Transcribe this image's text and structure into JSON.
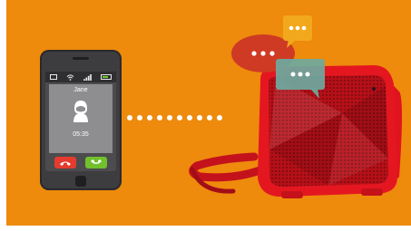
{
  "phone": {
    "contact_name": "Jane",
    "call_time": "05:35",
    "icons": [
      "mail-icon",
      "wifi-icon",
      "signal-icon",
      "battery-icon",
      "decline-call-icon",
      "accept-call-icon"
    ]
  },
  "colors": {
    "background": "#ee8a0c",
    "speaker_red": "#d8141f",
    "decline": "#e53b2f",
    "accept": "#72c02c",
    "bubble_red": "#cf3a24",
    "bubble_yellow": "#f2a81c",
    "bubble_teal": "#6ea9a0"
  },
  "connection_dots": 10
}
